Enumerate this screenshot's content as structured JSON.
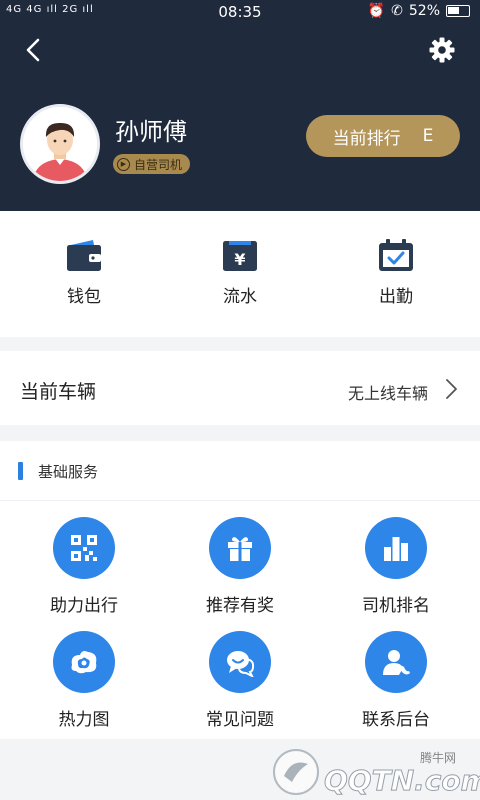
{
  "status_bar": {
    "network": "4G 4G ıll 2G ıll",
    "time": "08:35",
    "battery": "52%"
  },
  "header": {
    "back_icon": "chevron-left-icon",
    "settings_icon": "gear-icon"
  },
  "profile": {
    "name": "孙师傅",
    "badge": "自营司机",
    "rank_label": "当前排行",
    "rank_value": "E"
  },
  "quick_actions": [
    {
      "label": "钱包",
      "icon": "wallet-icon"
    },
    {
      "label": "流水",
      "icon": "yen-bill-icon"
    },
    {
      "label": "出勤",
      "icon": "calendar-check-icon"
    }
  ],
  "vehicle": {
    "title": "当前车辆",
    "value": "无上线车辆"
  },
  "services": {
    "section_title": "基础服务",
    "items": [
      {
        "label": "助力出行",
        "icon": "qr-code-icon"
      },
      {
        "label": "推荐有奖",
        "icon": "gift-icon"
      },
      {
        "label": "司机排名",
        "icon": "ranking-bars-icon"
      },
      {
        "label": "热力图",
        "icon": "heat-map-icon"
      },
      {
        "label": "常见问题",
        "icon": "chat-bubbles-icon"
      },
      {
        "label": "联系后台",
        "icon": "contact-person-icon"
      }
    ]
  },
  "watermark": {
    "site_name": "腾牛网",
    "logo_text": "QQTN.com"
  },
  "colors": {
    "header_bg": "#1f2a3c",
    "accent_gold": "#b4955a",
    "service_blue": "#2d86e8",
    "icon_navy": "#2b3b52"
  }
}
